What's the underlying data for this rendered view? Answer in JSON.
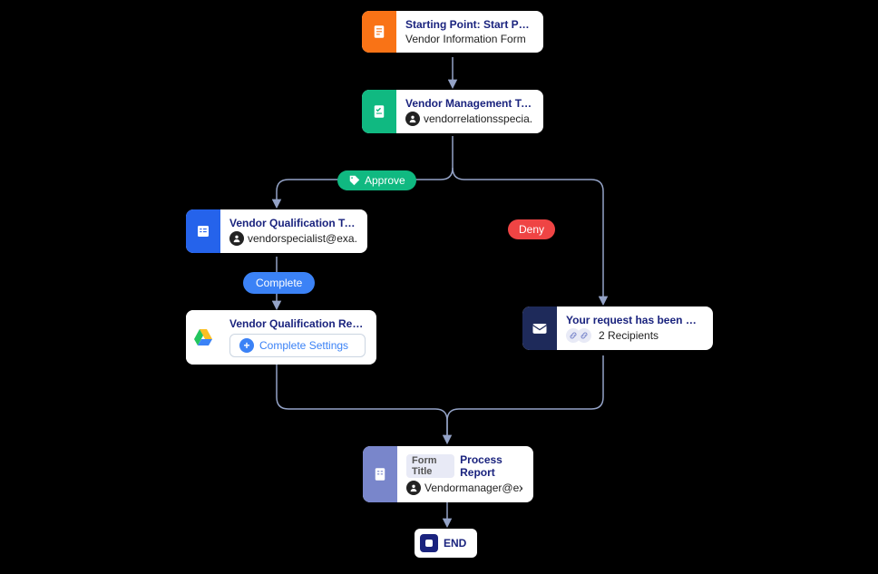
{
  "nodes": {
    "start": {
      "title": "Starting Point: Start Point",
      "subtitle": "Vendor Information Form",
      "color": "#f97316"
    },
    "vendor_mgmt": {
      "title": "Vendor Management Team",
      "user": "vendorrelationsspecia...",
      "color": "#10b981"
    },
    "qual_task": {
      "title": "Vendor Qualification Task",
      "user": "vendorspecialist@exa...",
      "color": "#2563eb"
    },
    "reports": {
      "title": "Vendor Qualification Reports...",
      "button": "Complete Settings"
    },
    "denied": {
      "title": "Your request has been denied.",
      "recipients": "2 Recipients",
      "color": "#1e2a5a"
    },
    "process": {
      "chip": "Form Title",
      "title": "Process Report",
      "user": "Vendormanager@exa...",
      "color": "#7986cb"
    },
    "end": {
      "label": "END"
    }
  },
  "edges": {
    "approve": "Approve",
    "deny": "Deny",
    "complete": "Complete"
  }
}
